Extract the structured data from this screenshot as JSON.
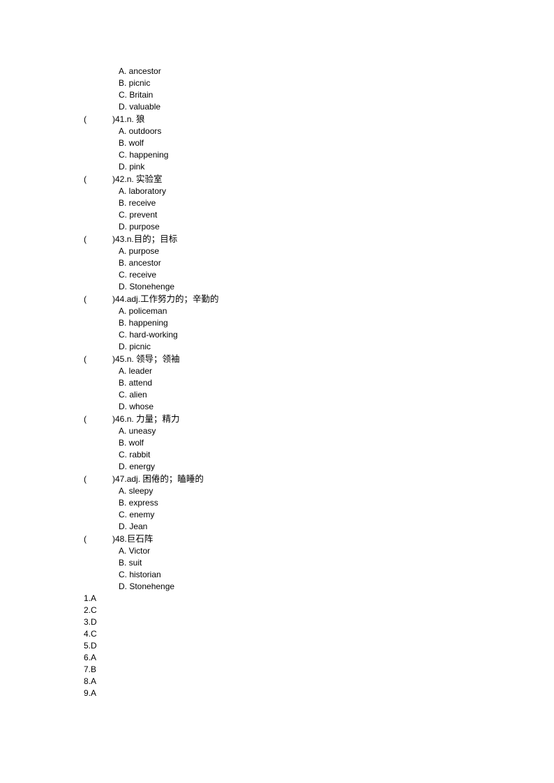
{
  "document": {
    "type": "vocabulary-multiple-choice-worksheet",
    "leading_options": [
      "A. ancestor",
      "B. picnic",
      "C. Britain",
      "D. valuable"
    ],
    "questions": [
      {
        "paren_open": "(",
        "paren_close": ")",
        "number": "41.",
        "pos": "n. ",
        "prompt_cn": "狼",
        "options": [
          "A. outdoors",
          "B. wolf",
          "C. happening",
          "D. pink"
        ]
      },
      {
        "paren_open": "(",
        "paren_close": ")",
        "number": "42.",
        "pos": "n. ",
        "prompt_cn": "实验室",
        "options": [
          "A. laboratory",
          "B. receive",
          "C. prevent",
          "D. purpose"
        ]
      },
      {
        "paren_open": "(",
        "paren_close": ")",
        "number": "43.",
        "pos": "n.",
        "prompt_cn": "目的；目标",
        "options": [
          "A. purpose",
          "B. ancestor",
          "C. receive",
          "D. Stonehenge"
        ]
      },
      {
        "paren_open": "(",
        "paren_close": ")",
        "number": "44.",
        "pos": "adj.",
        "prompt_cn": "工作努力的；辛勤的",
        "options": [
          "A. policeman",
          "B. happening",
          "C. hard-working",
          "D. picnic"
        ]
      },
      {
        "paren_open": "(",
        "paren_close": ")",
        "number": "45.",
        "pos": "n. ",
        "prompt_cn": "领导；领袖",
        "options": [
          "A. leader",
          "B. attend",
          "C. alien",
          "D. whose"
        ]
      },
      {
        "paren_open": "(",
        "paren_close": ")",
        "number": "46.",
        "pos": "n. ",
        "prompt_cn": "力量；精力",
        "options": [
          "A. uneasy",
          "B. wolf",
          "C. rabbit",
          "D. energy"
        ]
      },
      {
        "paren_open": "(",
        "paren_close": ")",
        "number": "47.",
        "pos": "adj. ",
        "prompt_cn": "困倦的；瞌睡的",
        "options": [
          "A. sleepy",
          "B. express",
          "C. enemy",
          "D. Jean"
        ]
      },
      {
        "paren_open": "(",
        "paren_close": ")",
        "number": "48.",
        "pos": "",
        "prompt_cn": "巨石阵",
        "options": [
          "A. Victor",
          "B. suit",
          "C. historian",
          "D. Stonehenge"
        ]
      }
    ],
    "answer_key": [
      "1.A",
      "2.C",
      "3.D",
      "4.C",
      "5.D",
      "6.A",
      "7.B",
      "8.A",
      "9.A"
    ]
  },
  "colors": {
    "page_background": "#ffffff",
    "text": "#000000"
  }
}
